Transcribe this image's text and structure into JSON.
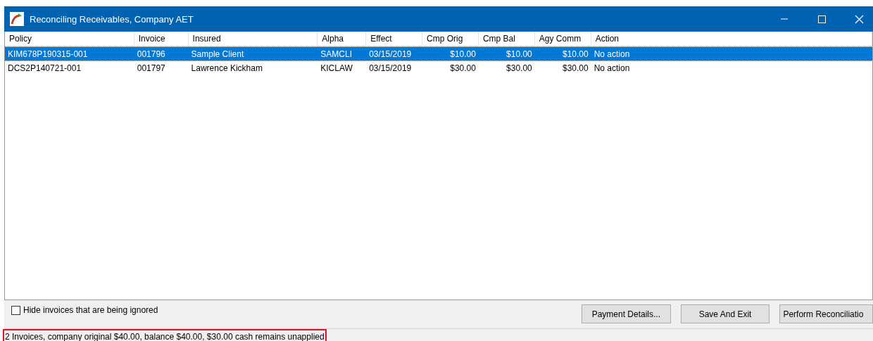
{
  "window": {
    "title": "Reconciling Receivables, Company AET"
  },
  "table": {
    "columns": [
      "Policy",
      "Invoice",
      "Insured",
      "Alpha",
      "Effect",
      "Cmp Orig",
      "Cmp Bal",
      "Agy Comm",
      "Action"
    ],
    "rows": [
      {
        "selected": true,
        "cells": [
          "KIM678P190315-001",
          "001796",
          "Sample Client",
          "SAMCLI",
          "03/15/2019",
          "$10.00",
          "$10.00",
          "$10.00",
          "No action"
        ]
      },
      {
        "selected": false,
        "cells": [
          "DCS2P140721-001",
          "001797",
          "Lawrence Kickham",
          "KICLAW",
          "03/15/2019",
          "$30.00",
          "$30.00",
          "$30.00",
          "No action"
        ]
      }
    ]
  },
  "hide_ignored": {
    "label": "Hide invoices that are being ignored",
    "checked": false
  },
  "buttons": [
    "Payment Details...",
    "Save And Exit",
    "Perform Reconciliatio"
  ],
  "status_bar": "2 Invoices, company original $40.00, balance $40.00, $30.00 cash remains unapplied"
}
